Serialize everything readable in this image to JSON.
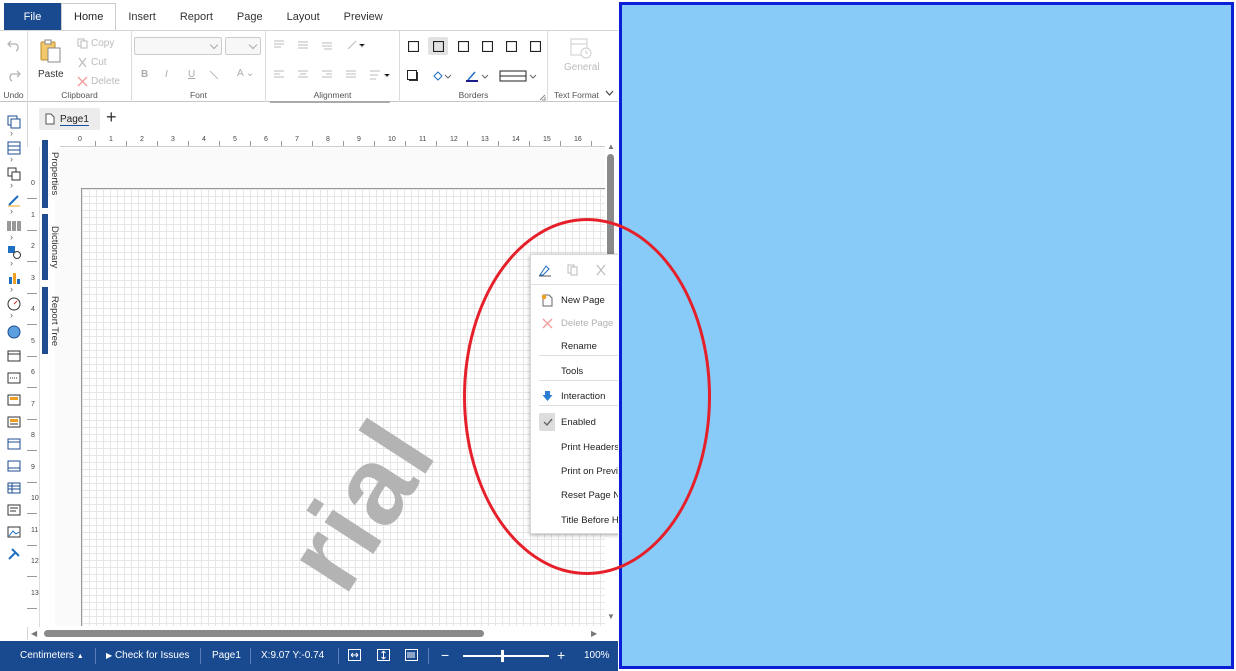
{
  "menu": {
    "file": "File",
    "tabs": [
      "Home",
      "Insert",
      "Report",
      "Page",
      "Layout",
      "Preview"
    ]
  },
  "ribbon": {
    "undo_label": "Undo",
    "clipboard": {
      "paste": "Paste",
      "copy": "Copy",
      "cut": "Cut",
      "delete": "Delete",
      "label": "Clipboard"
    },
    "font_label": "Font",
    "alignment_label": "Alignment",
    "borders_label": "Borders",
    "text_format": {
      "general": "General",
      "label": "Text Format"
    }
  },
  "page_tabs": {
    "current": "Page1",
    "add": "+"
  },
  "ruler": {
    "top": [
      "0",
      "1",
      "2",
      "3",
      "4",
      "5",
      "6",
      "7",
      "8",
      "9",
      "10",
      "11",
      "12",
      "13",
      "14",
      "15",
      "16"
    ],
    "left": [
      "0",
      "1",
      "2",
      "3",
      "4",
      "5",
      "6",
      "7",
      "8",
      "9",
      "10",
      "11",
      "12",
      "13"
    ]
  },
  "side_panels": [
    "Properties",
    "Dictionary",
    "Report Tree"
  ],
  "watermark": "rial",
  "context_menu": {
    "items": [
      {
        "label": "New Page",
        "icon": "new-page-icon",
        "disabled": false
      },
      {
        "label": "Delete Page",
        "icon": "delete-x-icon",
        "disabled": true
      },
      {
        "label": "Rename",
        "icon": "",
        "disabled": false
      },
      {
        "label": "Tools",
        "icon": "",
        "disabled": false
      },
      {
        "label": "Interaction",
        "icon": "interaction-arrow-icon",
        "disabled": false
      },
      {
        "label": "Enabled",
        "icon": "check-icon",
        "disabled": false,
        "checked": true
      },
      {
        "label": "Print Headers",
        "icon": "",
        "disabled": false
      },
      {
        "label": "Print on Previ",
        "icon": "",
        "disabled": false
      },
      {
        "label": "Reset Page N",
        "icon": "",
        "disabled": false
      },
      {
        "label": "Title Before H",
        "icon": "",
        "disabled": false
      }
    ]
  },
  "status_bar": {
    "units": "Centimeters",
    "check": "Check for Issues",
    "page": "Page1",
    "coords": "X:9.07 Y:-0.74",
    "zoom_minus": "−",
    "zoom_plus": "+",
    "zoom": "100%",
    "zoom_level": 0.5
  },
  "colors": {
    "accent": "#19498f",
    "overlay_panel": "#89cbf8",
    "overlay_border": "#0a1fd6",
    "annotation": "#e5202a"
  }
}
